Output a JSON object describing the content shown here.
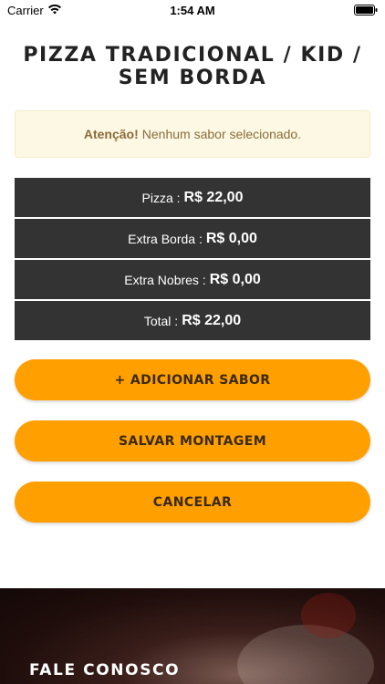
{
  "status_bar": {
    "carrier": "Carrier",
    "time": "1:54 AM",
    "icons": [
      "wifi-icon",
      "battery-icon"
    ]
  },
  "title": "PIZZA TRADICIONAL / KID / SEM BORDA",
  "alert": {
    "strong": "Atenção!",
    "message": "Nenhum sabor selecionado."
  },
  "summary": [
    {
      "label": "Pizza :",
      "value": "R$ 22,00"
    },
    {
      "label": "Extra Borda :",
      "value": "R$ 0,00"
    },
    {
      "label": "Extra Nobres :",
      "value": "R$ 0,00"
    },
    {
      "label": "Total :",
      "value": "R$ 22,00"
    }
  ],
  "buttons": {
    "add": "+ ADICIONAR SABOR",
    "save": "SALVAR MONTAGEM",
    "cancel": "CANCELAR"
  },
  "footer": {
    "title": "FALE CONOSCO"
  },
  "colors": {
    "accent": "#ff9f00",
    "row_bg": "#333333",
    "alert_bg": "#fcf8e3",
    "alert_text": "#8a6d3b"
  }
}
